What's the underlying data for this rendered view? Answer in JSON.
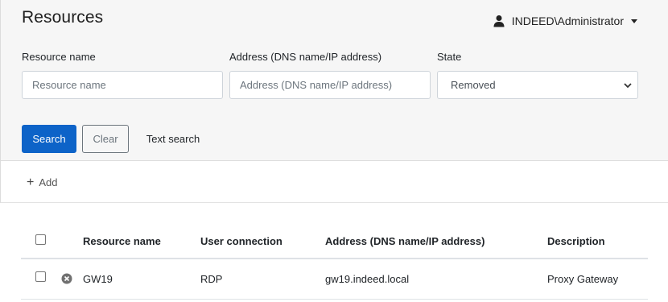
{
  "header": {
    "title": "Resources",
    "user": "INDEED\\Administrator"
  },
  "filters": {
    "resource_name": {
      "label": "Resource name",
      "placeholder": "Resource name",
      "value": ""
    },
    "address": {
      "label": "Address (DNS name/IP address)",
      "placeholder": "Address (DNS name/IP address)",
      "value": ""
    },
    "state": {
      "label": "State",
      "value": "Removed"
    }
  },
  "actions": {
    "search": "Search",
    "clear": "Clear",
    "text_search": "Text search"
  },
  "toolbar": {
    "add_label": "Add"
  },
  "table": {
    "columns": [
      "Resource name",
      "User connection",
      "Address (DNS name/IP address)",
      "Description"
    ],
    "rows": [
      {
        "name": "GW19",
        "connection": "RDP",
        "address": "gw19.indeed.local",
        "description": "Proxy Gateway",
        "status_icon": "removed-x-icon"
      }
    ]
  },
  "colors": {
    "primary": "#0d63c8",
    "panel_bg": "#f6f6f6",
    "secondary": "#6c757d"
  }
}
